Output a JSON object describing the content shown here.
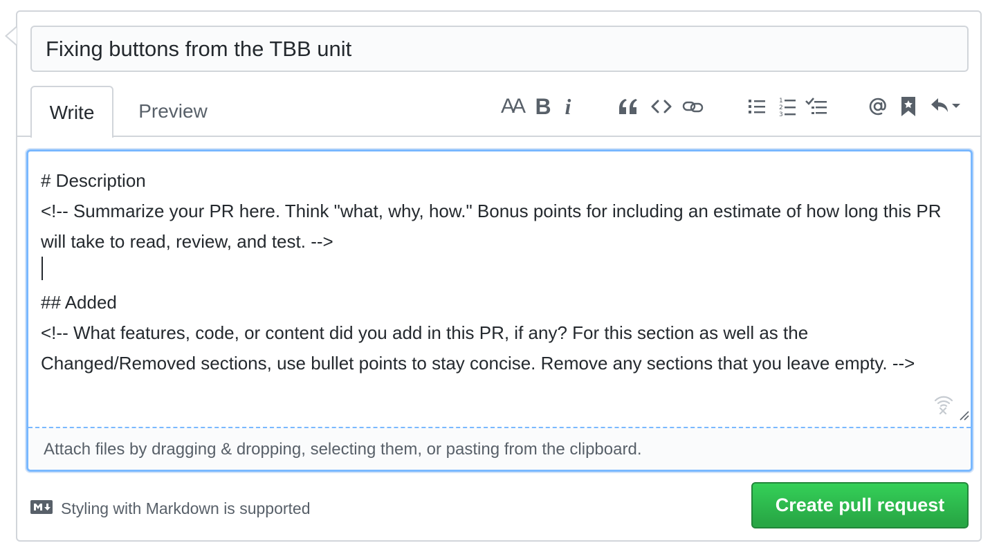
{
  "title_input": {
    "value": "Fixing buttons from the TBB unit"
  },
  "tabs": {
    "write": "Write",
    "preview": "Preview"
  },
  "toolbar": {
    "header": "AA",
    "bold": "B",
    "italic": "i"
  },
  "editor": {
    "body": "# Description\n<!-- Summarize your PR here. Think \"what, why, how.\" Bonus points for including an estimate of how long this PR will take to read, review, and test. -->\n\n## Added\n<!-- What features, code, or content did you add in this PR, if any? For this section as well as the Changed/Removed sections, use bullet points to stay concise. Remove any sections that you leave empty. -->",
    "attach_hint": "Attach files by dragging & dropping, selecting them, or pasting from the clipboard."
  },
  "footer": {
    "markdown_note": "Styling with Markdown is supported",
    "submit_label": "Create pull request"
  },
  "colors": {
    "accent_blue": "#79b8ff",
    "submit_green": "#28a745",
    "muted_text": "#586069"
  },
  "icons": [
    "header-icon",
    "bold-icon",
    "italic-icon",
    "quote-icon",
    "code-icon",
    "link-icon",
    "unordered-list-icon",
    "ordered-list-icon",
    "task-list-icon",
    "mention-icon",
    "bookmark-icon",
    "reply-icon",
    "markdown-icon",
    "wifi-icon",
    "resize-handle-icon"
  ]
}
